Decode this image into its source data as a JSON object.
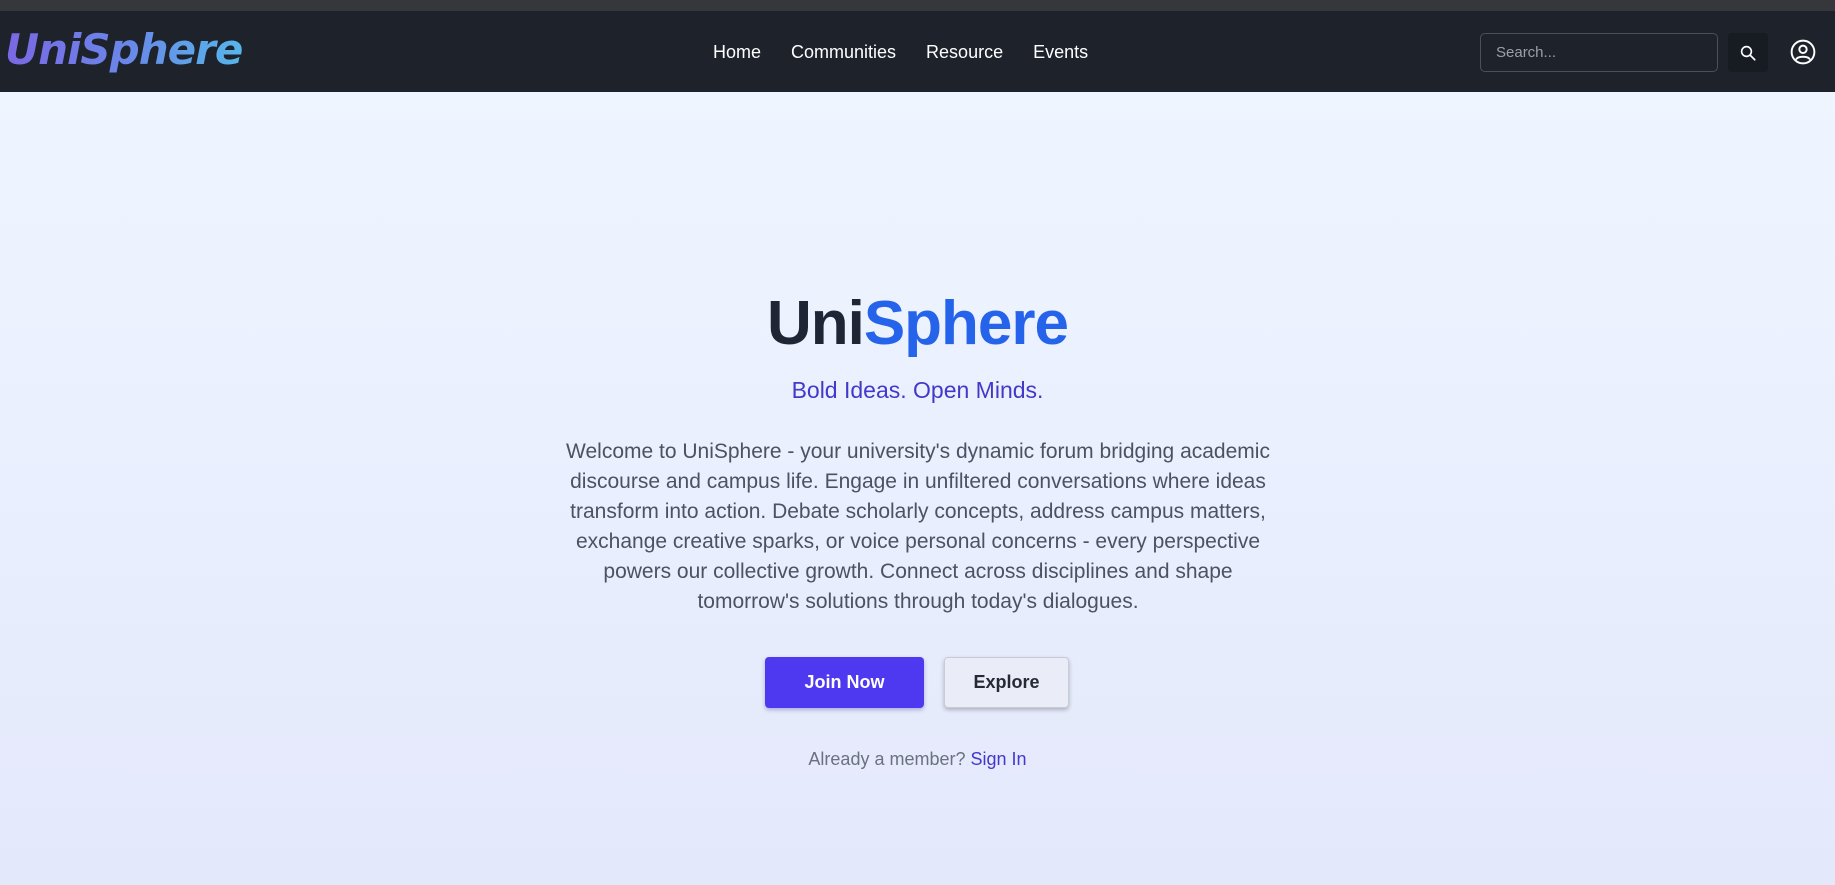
{
  "app": {
    "logo_text": "UniSphere"
  },
  "nav": {
    "links": [
      "Home",
      "Communities",
      "Resource",
      "Events"
    ],
    "search_placeholder": "Search...",
    "notification_badge": "!"
  },
  "hero": {
    "title_part1": "Uni",
    "title_part2": "Sphere",
    "tagline": "Bold Ideas. Open Minds.",
    "description": "Welcome to UniSphere - your university's dynamic forum bridging academic discourse and campus life. Engage in unfiltered conversations where ideas transform into action. Debate scholarly concepts, address campus matters, exchange creative sparks, or voice personal concerns - every perspective powers our collective growth. Connect across disciplines and shape tomorrow's solutions through today's dialogues.",
    "join_label": "Join Now",
    "explore_label": "Explore",
    "member_prompt": "Already a member?",
    "sign_in_label": "Sign In"
  },
  "colors": {
    "navbar": "#1d222b",
    "accent_blue": "#2563eb",
    "accent_indigo": "#4338ca",
    "join_button": "#4f39f0",
    "badge": "#f0b400"
  },
  "icons": {
    "search": "search-icon",
    "user": "user-circle-icon"
  }
}
